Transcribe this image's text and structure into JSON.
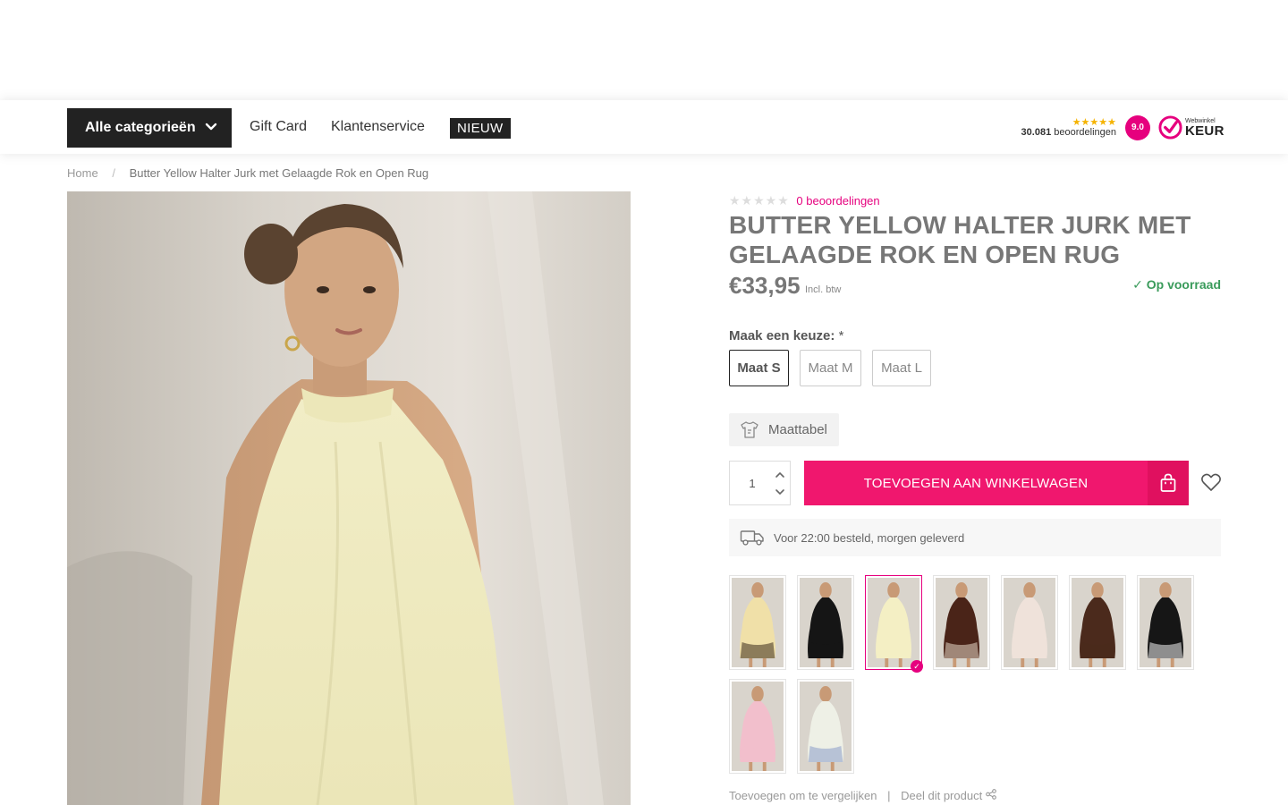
{
  "header": {
    "categories_label": "Alle categorieën",
    "nav": [
      "Gift Card",
      "Klantenservice"
    ],
    "new_label": "NIEUW",
    "reviews_count": "30.081",
    "reviews_word": "beoordelingen",
    "rating": "9.0",
    "keur_small": "Webwinkel",
    "keur_big": "KEUR"
  },
  "breadcrumb": {
    "home": "Home",
    "separator": "/",
    "current": "Butter Yellow Halter Jurk met Gelaagde Rok en Open Rug"
  },
  "product": {
    "reviews_label": "0 beoordelingen",
    "title": "BUTTER YELLOW HALTER JURK MET GELAAGDE ROK EN OPEN RUG",
    "price": "€33,95",
    "vat_label": "Incl. btw",
    "stock": "Op voorraad",
    "choice_label": "Maak een keuze:",
    "choice_required": "*",
    "sizes": [
      "Maat S",
      "Maat M",
      "Maat L"
    ],
    "selected_size": "Maat S",
    "size_chart_label": "Maattabel",
    "quantity": "1",
    "add_to_cart": "TOEVOEGEN AAN WINKELWAGEN",
    "delivery_text": "Voor 22:00 besteld, morgen geleverd",
    "compare_label": "Toevoegen om te vergelijken",
    "share_label": "Deel dit product"
  },
  "variants": [
    {
      "color": "#f0e0a8",
      "accent": "#3a2a1a"
    },
    {
      "color": "#151515",
      "accent": "#151515"
    },
    {
      "color": "#f4efc4",
      "accent": "#f4efc4",
      "selected": true
    },
    {
      "color": "#4a2418",
      "accent": "#e8d8c8"
    },
    {
      "color": "#efe2da",
      "accent": "#efe2da"
    },
    {
      "color": "#4b2a1c",
      "accent": "#4b2a1c"
    },
    {
      "color": "#161616",
      "accent": "#f2f2f2"
    },
    {
      "color": "#f2bfcc",
      "accent": "#f2bfcc"
    },
    {
      "color": "#eef0e6",
      "accent": "#8a9cc8"
    }
  ],
  "colors": {
    "brand_pink": "#f0176e",
    "stock_green": "#3a9b5b",
    "dark": "#222222"
  }
}
